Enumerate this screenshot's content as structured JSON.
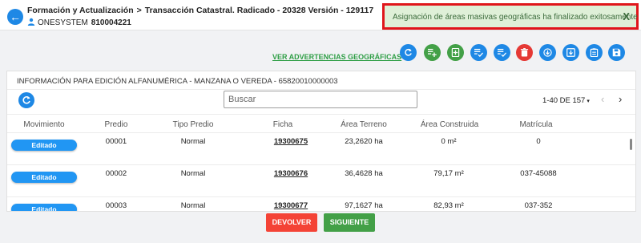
{
  "header": {
    "breadcrumb_1": "Formación y Actualización",
    "breadcrumb_sep": ">",
    "breadcrumb_2": "Transacción Catastral. Radicado - 20328 Versión - 129117",
    "user_name": "ONESYSTEM",
    "user_code": "810004221"
  },
  "toast": {
    "message": "Asignación de áreas masivas geográficas ha finalizado exitosamente",
    "close_label": "X"
  },
  "warnings_link": "VER ADVERTENCIAS GEOGRÁFICAS",
  "toolbar": {
    "icons": [
      {
        "name": "refresh-icon",
        "color": "#1e88e5"
      },
      {
        "name": "playlist-add-icon",
        "color": "#43a047"
      },
      {
        "name": "note-add-icon",
        "color": "#43a047"
      },
      {
        "name": "playlist-check-icon",
        "color": "#1e88e5"
      },
      {
        "name": "playlist-check-alt-icon",
        "color": "#1e88e5"
      },
      {
        "name": "delete-sweep-icon",
        "color": "#e53935"
      },
      {
        "name": "download-circle-icon",
        "color": "#1e88e5"
      },
      {
        "name": "file-download-icon",
        "color": "#1e88e5"
      },
      {
        "name": "clipboard-list-icon",
        "color": "#1e88e5"
      },
      {
        "name": "save-icon",
        "color": "#1e88e5"
      }
    ]
  },
  "panel": {
    "title": "INFORMACIÓN PARA EDICIÓN ALFANUMÉRICA - MANZANA O VEREDA - 65820010000003",
    "search_placeholder": "Buscar",
    "pager_text": "1-40 DE 157",
    "pager_caret": "▾",
    "prev_icon": "‹",
    "next_icon": "›"
  },
  "table": {
    "columns": [
      "Movimiento",
      "Predio",
      "Tipo Predio",
      "Ficha",
      "Área Terreno",
      "Área Construida",
      "Matrícula"
    ],
    "rows": [
      {
        "movimiento": "Editado",
        "predio": "00001",
        "tipo": "Normal",
        "ficha": "19300675",
        "area_terreno": "23,2620 ha",
        "area_construida": "0 m²",
        "matricula": "0"
      },
      {
        "movimiento": "Editado",
        "predio": "00002",
        "tipo": "Normal",
        "ficha": "19300676",
        "area_terreno": "36,4628 ha",
        "area_construida": "79,17 m²",
        "matricula": "037-45088"
      },
      {
        "movimiento": "Editado",
        "predio": "00003",
        "tipo": "Normal",
        "ficha": "19300677",
        "area_terreno": "97,1627 ha",
        "area_construida": "82,93 m²",
        "matricula": "037-352"
      }
    ]
  },
  "footer": {
    "devolver_label": "DEVOLVER",
    "siguiente_label": "SIGUIENTE"
  },
  "colors": {
    "primary": "#1e88e5",
    "success": "#43a047",
    "danger": "#f44336",
    "toast_bg": "#dff0d8",
    "toast_border": "#e0161b"
  }
}
